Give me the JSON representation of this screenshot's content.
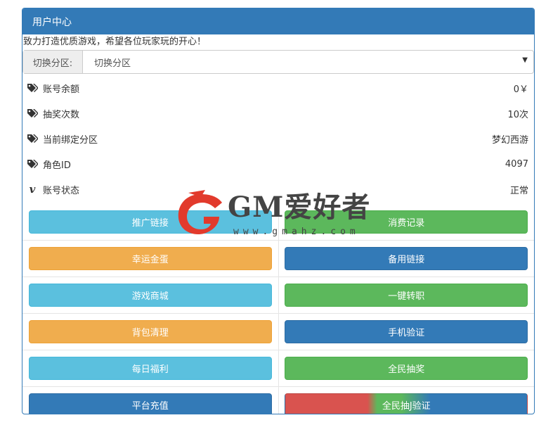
{
  "panel": {
    "title": "用户中心"
  },
  "slogan": "致力打造优质游戏，希望各位玩家玩的开心！",
  "zone": {
    "label": "切换分区:",
    "selected": "切换分区"
  },
  "info": [
    {
      "icon": "tags-icon",
      "label": "账号余额",
      "value": "0￥"
    },
    {
      "icon": "tags-icon",
      "label": "抽奖次数",
      "value": "10次"
    },
    {
      "icon": "tags-icon",
      "label": "当前绑定分区",
      "value": "梦幻西游"
    },
    {
      "icon": "tags-icon",
      "label": "角色ID",
      "value": "4097"
    },
    {
      "icon": "vimeo-icon",
      "label": "账号状态",
      "value": "正常"
    }
  ],
  "buttons": [
    [
      "推广链接",
      "消费记录"
    ],
    [
      "幸运金蛋",
      "备用链接"
    ],
    [
      "游戏商城",
      "一键转职"
    ],
    [
      "背包清理",
      "手机验证"
    ],
    [
      "每日福利",
      "全民抽奖"
    ],
    [
      "平台充值",
      "全民抽J验证"
    ]
  ],
  "watermark": {
    "title": "GM爱好者",
    "url": "www.gmahz.com"
  },
  "colors": {
    "primary": "#337ab7",
    "info": "#5bc0de",
    "success": "#5cb85c",
    "warning": "#f0ad4e",
    "danger": "#d9534f"
  }
}
